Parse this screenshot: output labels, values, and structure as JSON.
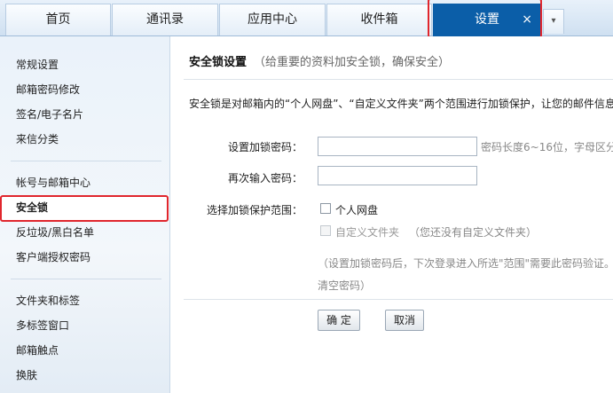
{
  "tabs": [
    {
      "label": "首页"
    },
    {
      "label": "通讯录"
    },
    {
      "label": "应用中心"
    },
    {
      "label": "收件箱"
    }
  ],
  "active_tab": {
    "label": "设置",
    "close": "×"
  },
  "tab_more": "▾",
  "sidebar": {
    "items": [
      {
        "label": "常规设置"
      },
      {
        "label": "邮箱密码修改"
      },
      {
        "label": "签名/电子名片"
      },
      {
        "label": "来信分类"
      },
      {
        "label": "帐号与邮箱中心"
      },
      {
        "label": "安全锁",
        "active": true
      },
      {
        "label": "反垃圾/黑白名单"
      },
      {
        "label": "客户端授权密码"
      },
      {
        "label": "文件夹和标签"
      },
      {
        "label": "多标签窗口"
      },
      {
        "label": "邮箱触点"
      },
      {
        "label": "换肤"
      }
    ]
  },
  "main": {
    "title": "安全锁设置",
    "subtitle": "（给重要的资料加安全锁，确保安全）",
    "description": "安全锁是对邮箱内的“个人网盘”、“自定义文件夹”两个范围进行加锁保护，让您的邮件信息更",
    "form": {
      "set_password_label": "设置加锁密码：",
      "set_password_value": "",
      "password_hint": "密码长度6~16位，字母区分",
      "confirm_password_label": "再次输入密码：",
      "confirm_password_value": "",
      "scope_label": "选择加锁保护范围：",
      "scope_options": [
        {
          "label": "个人网盘",
          "checked": false,
          "disabled": false
        },
        {
          "label": "自定义文件夹",
          "checked": false,
          "disabled": true
        }
      ],
      "no_folder_note": "（您还没有自定义文件夹）",
      "note_line1": "（设置加锁密码后，下次登录进入所选\"范围\"需要此密码验证。",
      "note_line2": "清空密码）"
    },
    "buttons": {
      "ok": "确 定",
      "cancel": "取消"
    }
  },
  "colors": {
    "accent": "#0b5ea8",
    "highlight": "#e0262d"
  }
}
